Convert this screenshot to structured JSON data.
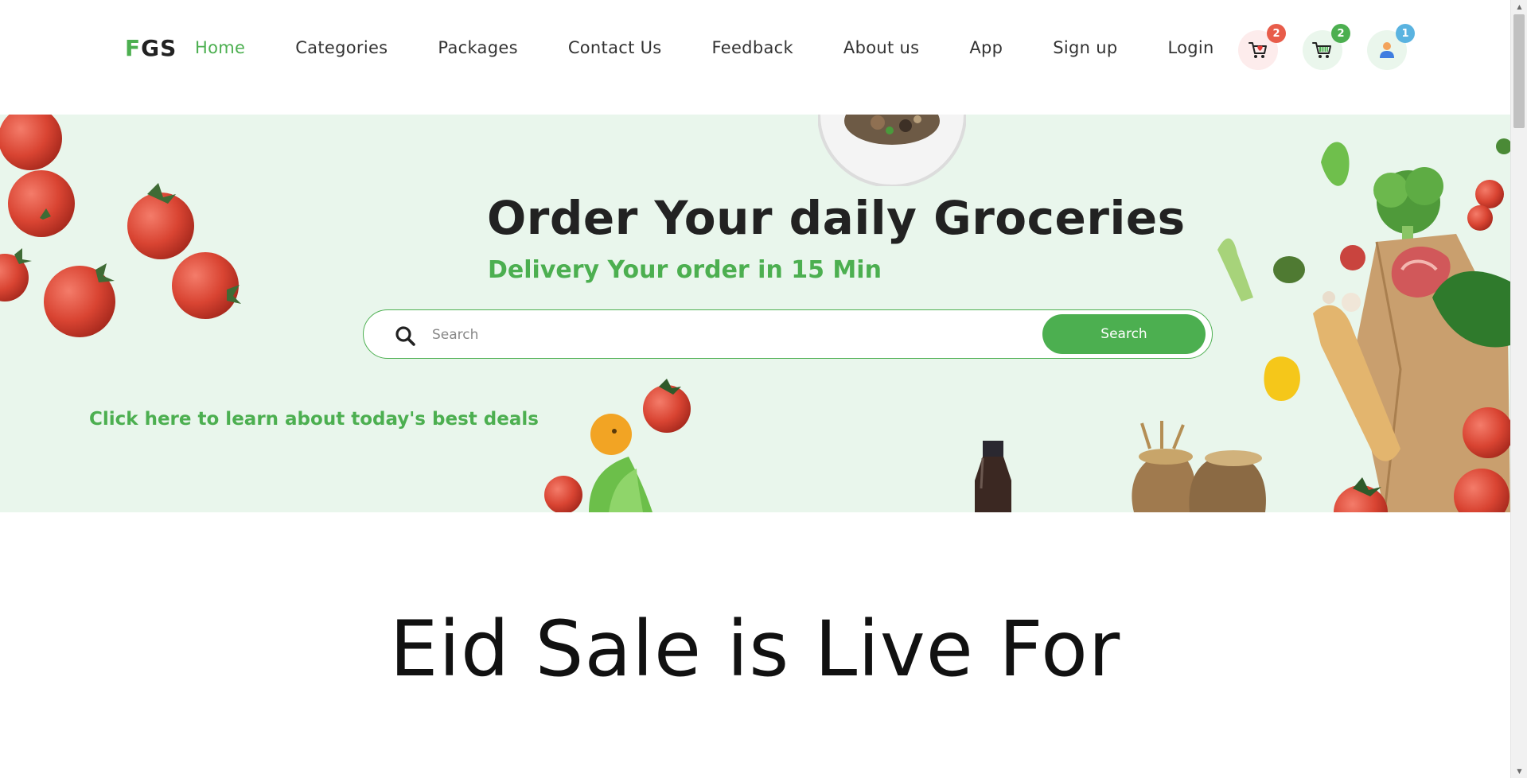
{
  "header": {
    "logo": {
      "first": "F",
      "rest": "GS"
    },
    "nav": [
      {
        "label": "Home",
        "active": true
      },
      {
        "label": "Categories"
      },
      {
        "label": "Packages"
      },
      {
        "label": "Contact Us"
      },
      {
        "label": "Feedback"
      },
      {
        "label": "About us"
      },
      {
        "label": "App"
      },
      {
        "label": "Sign up"
      },
      {
        "label": "Login"
      }
    ],
    "icons": {
      "wishlist": {
        "icon": "heart-cart-icon",
        "count": "2"
      },
      "cart": {
        "icon": "basket-cart-icon",
        "count": "2"
      },
      "user": {
        "icon": "user-icon",
        "count": "1"
      }
    }
  },
  "hero": {
    "title": "Order Your daily Groceries",
    "subtitle": "Delivery Your order in 15 Min",
    "search": {
      "placeholder": "Search",
      "value": "",
      "button_label": "Search"
    },
    "deals_link": "Click here to learn about today's best deals"
  },
  "sale": {
    "title": "Eid Sale is Live For"
  },
  "colors": {
    "accent": "#4caf50",
    "hero_bg": "#e9f6ec",
    "wishlist_badge": "#e85c4a",
    "cart_badge": "#4caf50",
    "user_badge": "#5ab3e0"
  }
}
